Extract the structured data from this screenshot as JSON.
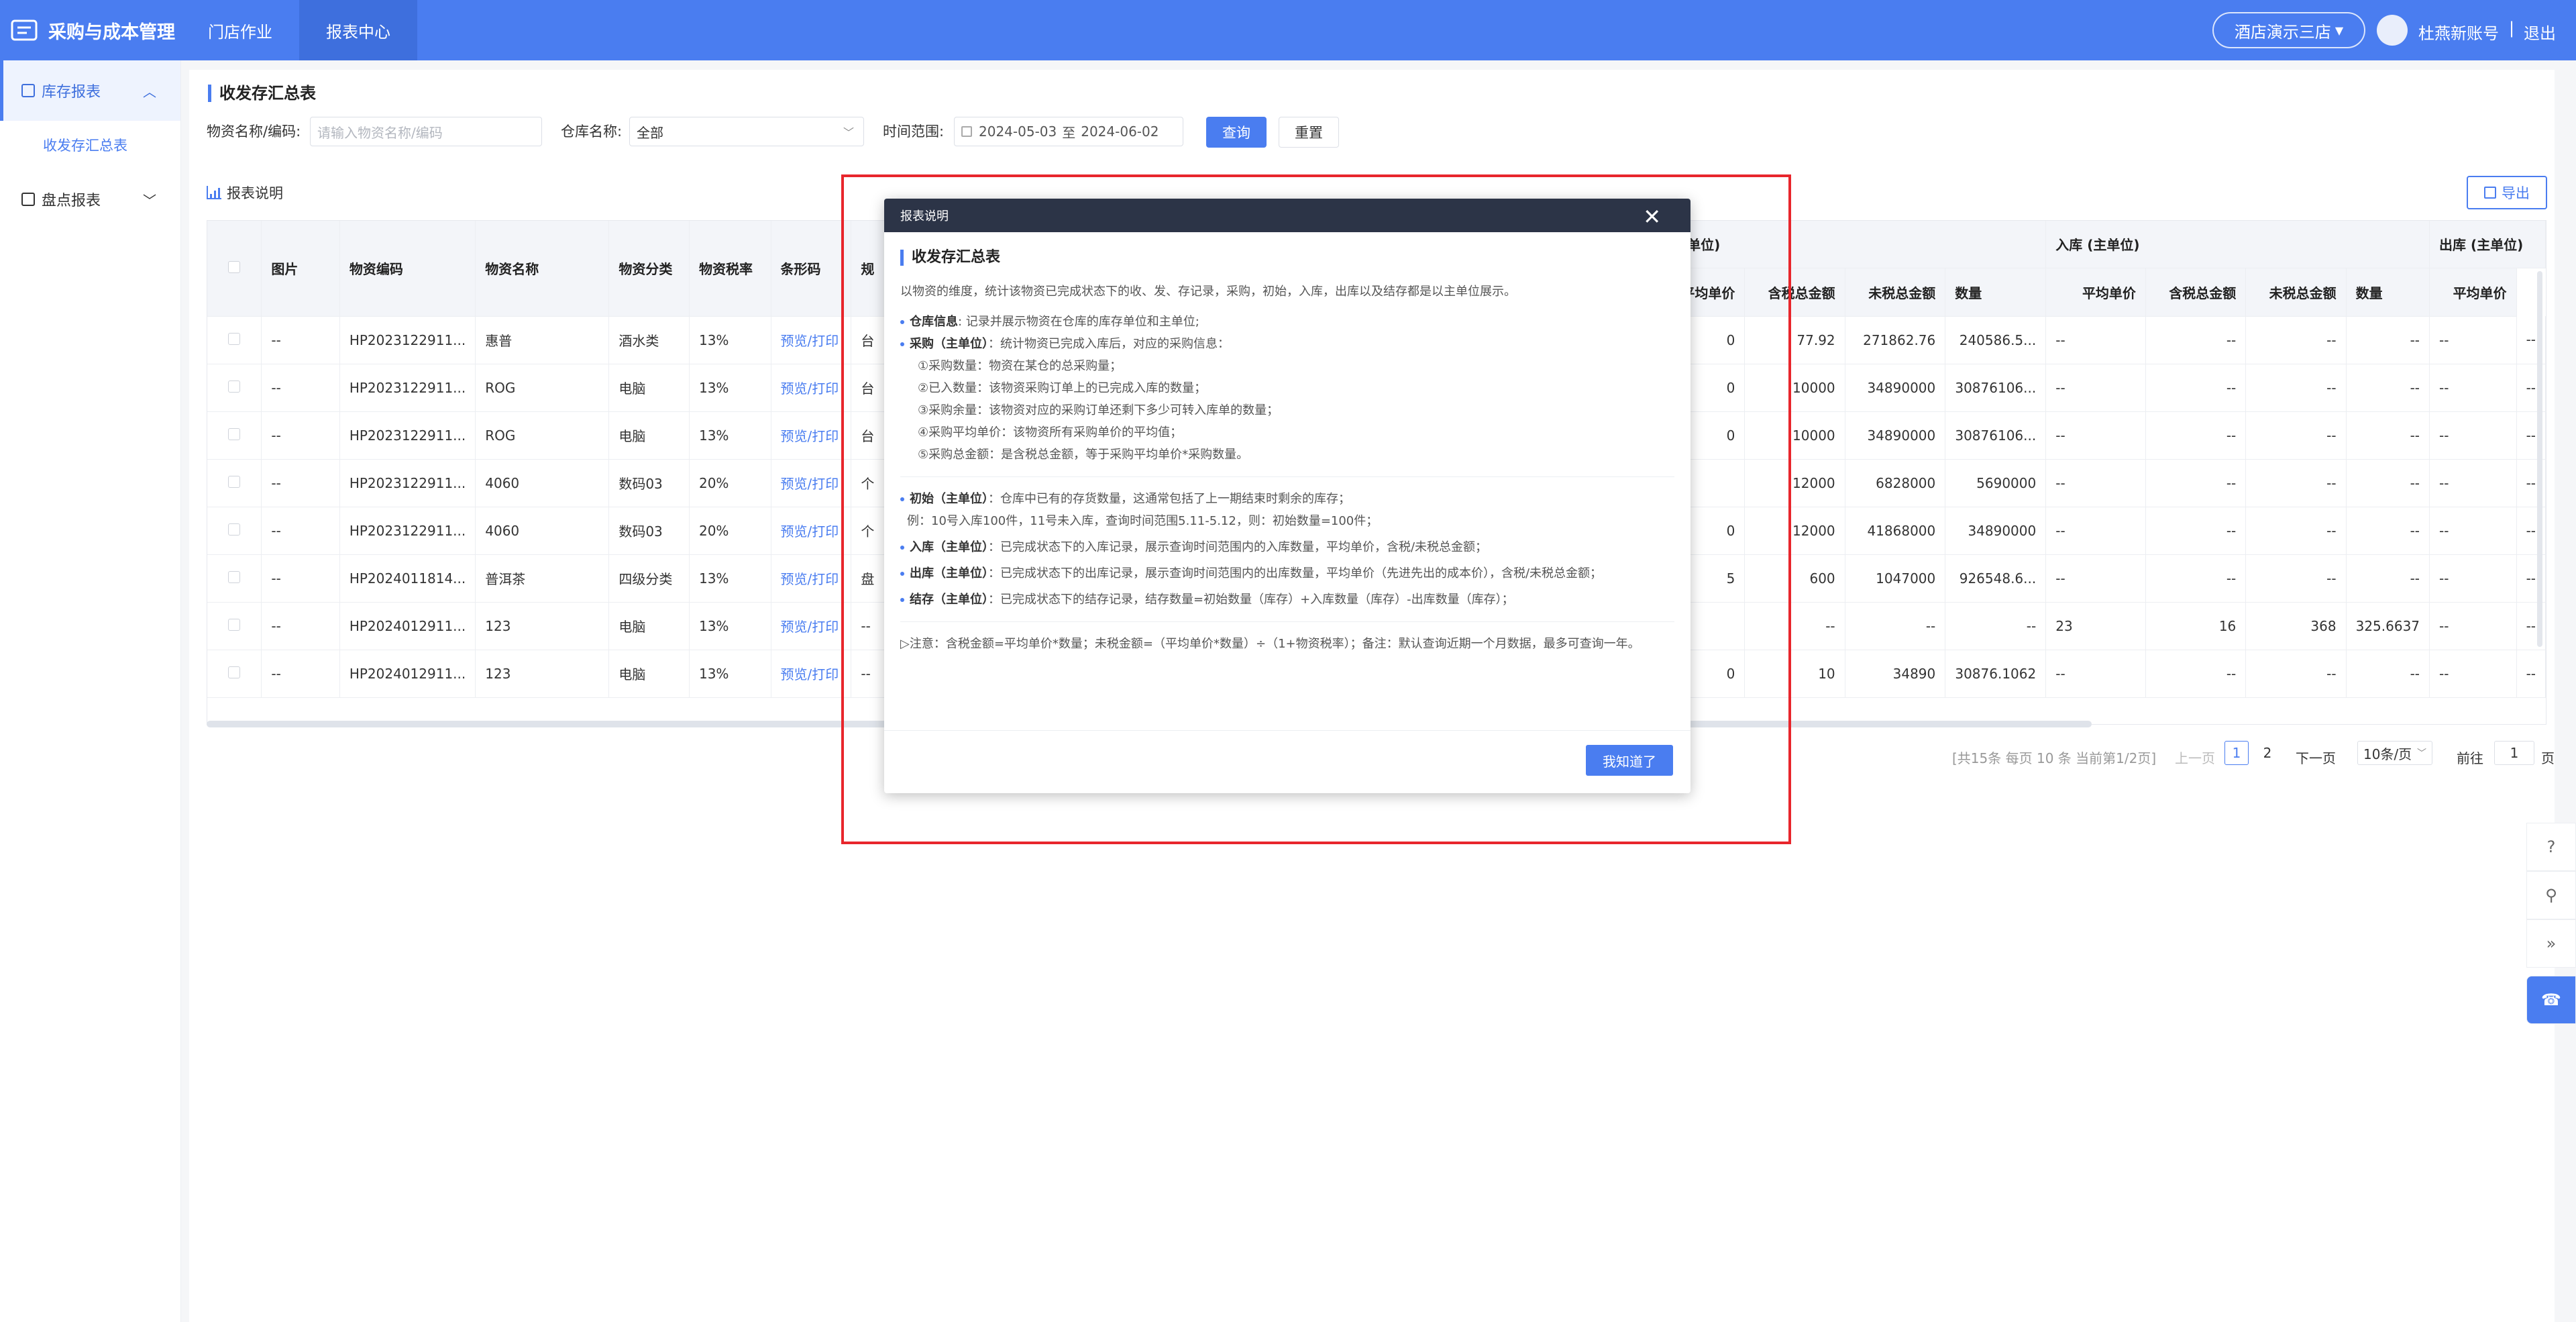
{
  "app": {
    "title": "采购与成本管理"
  },
  "nav": {
    "items": [
      "门店作业",
      "报表中心"
    ]
  },
  "header": {
    "store": "酒店演示三店",
    "user": "杜燕新账号",
    "separator": "|",
    "logout": "退出"
  },
  "sidebar": {
    "group1": "库存报表",
    "group1_sub": "收发存汇总表",
    "group2": "盘点报表"
  },
  "page": {
    "title": "收发存汇总表"
  },
  "filters": {
    "material_label": "物资名称/编码:",
    "material_placeholder": "请输入物资名称/编码",
    "warehouse_label": "仓库名称:",
    "warehouse_value": "全部",
    "time_label": "时间范围:",
    "time_start": "2024-05-03",
    "time_to": "至",
    "time_end": "2024-06-02",
    "query": "查询",
    "reset": "重置"
  },
  "toolbar": {
    "report_desc": "报表说明",
    "export": "导出"
  },
  "table": {
    "headers": [
      "图片",
      "物资编码",
      "物资名称",
      "物资分类",
      "物资税率",
      "条形码",
      "规"
    ],
    "group_headers": {
      "purchase": "(主单位)",
      "inbound": "入库 (主单位)",
      "outbound": "出库 (主单位)"
    },
    "purchase_cols": [
      "平均单价",
      "含税总金额",
      "未税总金额"
    ],
    "inbound_cols": [
      "数量",
      "平均单价",
      "含税总金额",
      "未税总金额"
    ],
    "outbound_cols": [
      "数量",
      "平均单价"
    ],
    "rows": [
      {
        "img": "--",
        "code": "HP2023122911...",
        "name": "惠普",
        "cat": "酒水类",
        "tax": "13%",
        "bar": "预览/打印",
        "spec": "台",
        "p_edge": "0",
        "p_avg": "77.92",
        "p_tax": "271862.76",
        "p_notax": "240586.5...",
        "i_qty": "--",
        "i_avg": "--",
        "i_tax": "--",
        "i_notax": "--",
        "o_qty": "--",
        "o_avg": "--"
      },
      {
        "img": "--",
        "code": "HP2023122911...",
        "name": "ROG",
        "cat": "电脑",
        "tax": "13%",
        "bar": "预览/打印",
        "spec": "台",
        "p_edge": "0",
        "p_avg": "10000",
        "p_tax": "34890000",
        "p_notax": "30876106...",
        "i_qty": "--",
        "i_avg": "--",
        "i_tax": "--",
        "i_notax": "--",
        "o_qty": "--",
        "o_avg": "--"
      },
      {
        "img": "--",
        "code": "HP2023122911...",
        "name": "ROG",
        "cat": "电脑",
        "tax": "13%",
        "bar": "预览/打印",
        "spec": "台",
        "p_edge": "0",
        "p_avg": "10000",
        "p_tax": "34890000",
        "p_notax": "30876106...",
        "i_qty": "--",
        "i_avg": "--",
        "i_tax": "--",
        "i_notax": "--",
        "o_qty": "--",
        "o_avg": "--"
      },
      {
        "img": "--",
        "code": "HP2023122911...",
        "name": "4060",
        "cat": "数码03",
        "tax": "20%",
        "bar": "预览/打印",
        "spec": "个",
        "p_edge": "",
        "p_avg": "12000",
        "p_tax": "6828000",
        "p_notax": "5690000",
        "i_qty": "--",
        "i_avg": "--",
        "i_tax": "--",
        "i_notax": "--",
        "o_qty": "--",
        "o_avg": "--"
      },
      {
        "img": "--",
        "code": "HP2023122911...",
        "name": "4060",
        "cat": "数码03",
        "tax": "20%",
        "bar": "预览/打印",
        "spec": "个",
        "p_edge": "0",
        "p_avg": "12000",
        "p_tax": "41868000",
        "p_notax": "34890000",
        "i_qty": "--",
        "i_avg": "--",
        "i_tax": "--",
        "i_notax": "--",
        "o_qty": "--",
        "o_avg": "--"
      },
      {
        "img": "--",
        "code": "HP2024011814...",
        "name": "普洱茶",
        "cat": "四级分类",
        "tax": "13%",
        "bar": "预览/打印",
        "spec": "盘",
        "p_edge": "5",
        "p_avg": "600",
        "p_tax": "1047000",
        "p_notax": "926548.6...",
        "i_qty": "--",
        "i_avg": "--",
        "i_tax": "--",
        "i_notax": "--",
        "o_qty": "--",
        "o_avg": "--"
      },
      {
        "img": "--",
        "code": "HP2024012911...",
        "name": "123",
        "cat": "电脑",
        "tax": "13%",
        "bar": "预览/打印",
        "spec": "--",
        "p_edge": "",
        "p_avg": "--",
        "p_tax": "--",
        "p_notax": "--",
        "i_qty": "23",
        "i_avg": "16",
        "i_tax": "368",
        "i_notax": "325.6637",
        "o_qty": "--",
        "o_avg": "--"
      },
      {
        "img": "--",
        "code": "HP2024012911...",
        "name": "123",
        "cat": "电脑",
        "tax": "13%",
        "bar": "预览/打印",
        "spec": "--",
        "p_edge": "0",
        "p_avg": "10",
        "p_tax": "34890",
        "p_notax": "30876.1062",
        "i_qty": "--",
        "i_avg": "--",
        "i_tax": "--",
        "i_notax": "--",
        "o_qty": "--",
        "o_avg": "--"
      }
    ]
  },
  "pagination": {
    "summary": "[共15条 每页 10 条 当前第1/2页]",
    "prev": "上一页",
    "pages": [
      "1",
      "2"
    ],
    "next": "下一页",
    "page_size": "10条/页",
    "goto": "前往",
    "goto_value": "1",
    "page_unit": "页"
  },
  "modal": {
    "title": "报表说明",
    "heading": "收发存汇总表",
    "intro": "以物资的维度，统计该物资已完成状态下的收、发、存记录，采购，初始，入库，出库以及结存都是以主单位展示。",
    "warehouse_term": "仓库信息",
    "warehouse_desc": ": 记录并展示物资在仓库的库存单位和主单位;",
    "purchase_term": "采购（主单位）",
    "purchase_desc": "：统计物资已完成入库后，对应的采购信息：",
    "purchase_items": [
      "①采购数量：物资在某仓的总采购量；",
      "②已入数量：该物资采购订单上的已完成入库的数量；",
      "③采购余量：该物资对应的采购订单还剩下多少可转入库单的数量；",
      "④采购平均单价：该物资所有采购单价的平均值；",
      "⑤采购总金额：是含税总金额，等于采购平均单价*采购数量。"
    ],
    "initial_term": "初始（主单位）",
    "initial_desc": "：仓库中已有的存货数量，这通常包括了上一期结束时剩余的库存；",
    "initial_example": "例：10号入库100件，11号未入库，查询时间范围5.11-5.12，则：初始数量=100件；",
    "inbound_term": "入库（主单位）",
    "inbound_desc": "：已完成状态下的入库记录，展示查询时间范围内的入库数量，平均单价，含税/未税总金额；",
    "outbound_term": "出库（主单位）",
    "outbound_desc": "：已完成状态下的出库记录，展示查询时间范围内的出库数量，平均单价（先进先出的成本价），含税/未税总金额；",
    "stock_term": "结存（主单位）",
    "stock_desc": "：已完成状态下的结存记录，结存数量=初始数量（库存）+入库数量（库存）-出库数量（库存）；",
    "note": "▷注意：含税金额=平均单价*数量；未税金额=（平均单价*数量）÷（1+物资税率）；备注：默认查询近期一个月数据，最多可查询一年。",
    "ok": "我知道了"
  },
  "colors": {
    "brand": "#4a7df0",
    "modal_header": "#2c3447",
    "highlight_frame": "#e8262c"
  }
}
